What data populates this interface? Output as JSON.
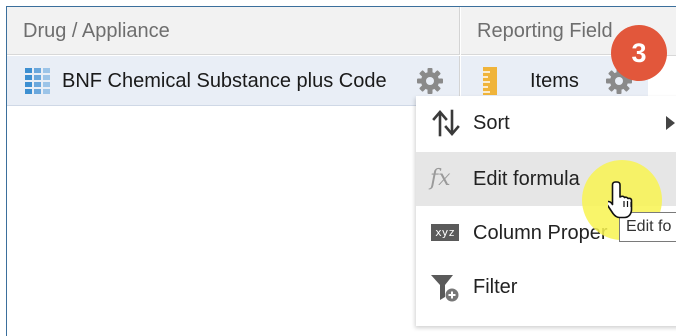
{
  "columns": {
    "left_header": "Drug / Appliance",
    "right_header": "Reporting Field"
  },
  "row": {
    "left_label": "BNF Chemical Substance plus Code",
    "right_label": "Items",
    "left_icon": "table-grid-icon",
    "right_icon": "ruler-measure-icon"
  },
  "menu": {
    "items": [
      {
        "label": "Sort",
        "icon": "sort-arrows-icon",
        "has_submenu": true
      },
      {
        "label": "Edit formula",
        "icon": "fx-icon",
        "hovered": true
      },
      {
        "label": "Column Proper",
        "icon": "xyz-icon"
      },
      {
        "label": "Filter",
        "icon": "filter-icon"
      }
    ]
  },
  "tooltip": "Edit fo",
  "step_badge": "3",
  "colors": {
    "badge": "#e2573b",
    "highlight": "#f8f350",
    "row_bg": "#e9eef6",
    "header_bg": "#f2f2f2"
  }
}
